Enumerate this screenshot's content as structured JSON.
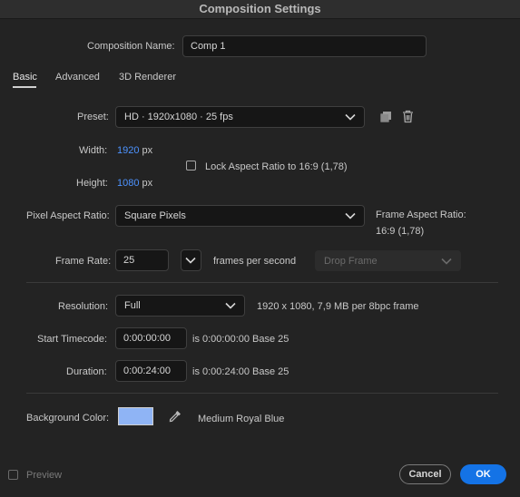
{
  "window": {
    "title": "Composition Settings"
  },
  "comp_name": {
    "label": "Composition Name:",
    "value": "Comp 1"
  },
  "tabs": [
    {
      "label": "Basic",
      "active": true
    },
    {
      "label": "Advanced",
      "active": false
    },
    {
      "label": "3D Renderer",
      "active": false
    }
  ],
  "preset": {
    "label": "Preset:",
    "value": "HD  ·  1920x1080 · 25 fps"
  },
  "width": {
    "label": "Width:",
    "value": "1920",
    "unit": "px"
  },
  "height": {
    "label": "Height:",
    "value": "1080",
    "unit": "px"
  },
  "lock_aspect": {
    "label": "Lock Aspect Ratio to 16:9 (1,78)",
    "checked": false
  },
  "pixel_aspect": {
    "label": "Pixel Aspect Ratio:",
    "value": "Square Pixels"
  },
  "frame_aspect": {
    "label": "Frame Aspect Ratio:",
    "value": "16:9 (1,78)"
  },
  "frame_rate": {
    "label": "Frame Rate:",
    "value": "25",
    "unit": "frames per second",
    "drop_frame": "Drop Frame"
  },
  "resolution": {
    "label": "Resolution:",
    "value": "Full",
    "info": "1920 x 1080, 7,9 MB per 8bpc frame"
  },
  "start_timecode": {
    "label": "Start Timecode:",
    "value": "0:00:00:00",
    "is": "is 0:00:00:00  Base 25"
  },
  "duration": {
    "label": "Duration:",
    "value": "0:00:24:00",
    "is": "is 0:00:24:00  Base 25"
  },
  "background": {
    "label": "Background Color:",
    "name": "Medium Royal Blue",
    "color": "#8fb4f5"
  },
  "footer": {
    "preview_label": "Preview",
    "cancel_label": "Cancel",
    "ok_label": "OK"
  },
  "colors": {
    "accent": "#1473e6",
    "link_value": "#4d93ff"
  }
}
